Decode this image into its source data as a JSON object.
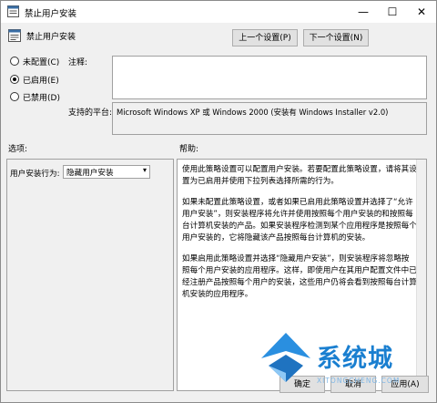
{
  "window": {
    "title": "禁止用户安装",
    "minimize_glyph": "—",
    "maximize_glyph": "☐",
    "close_glyph": "✕"
  },
  "header": {
    "policy_name": "禁止用户安装",
    "prev_button": "上一个设置(P)",
    "next_button": "下一个设置(N)"
  },
  "state": {
    "options": [
      {
        "label": "未配置(C)",
        "selected": false
      },
      {
        "label": "已启用(E)",
        "selected": true
      },
      {
        "label": "已禁用(D)",
        "selected": false
      }
    ]
  },
  "comment": {
    "label": "注释:",
    "value": ""
  },
  "platform": {
    "label": "支持的平台:",
    "value": "Microsoft Windows XP 或 Windows 2000 (安装有 Windows Installer v2.0)"
  },
  "options_panel": {
    "title": "选项:",
    "field_label": "用户安装行为:",
    "selected_value": "隐藏用户安装"
  },
  "help_panel": {
    "title": "帮助:",
    "paragraphs": [
      "使用此策略设置可以配置用户安装。若要配置此策略设置，请将其设置为已启用并使用下拉列表选择所需的行为。",
      "如果未配置此策略设置，或者如果已启用此策略设置并选择了“允许用户安装”，则安装程序将允许并使用按照每个用户安装的和按照每台计算机安装的产品。如果安装程序检测到某个应用程序是按照每个用户安装的，它将隐藏该产品按照每台计算机的安装。",
      "如果启用此策略设置并选择“隐藏用户安装”，则安装程序将忽略按照每个用户安装的应用程序。这样，即使用户在其用户配置文件中已经注册产品按照每个用户的安装，这些用户仍将会看到按照每台计算机安装的应用程序。"
    ]
  },
  "footer": {
    "ok_button": "确定",
    "cancel_button": "取消",
    "apply_button": "应用(A)"
  },
  "watermark": {
    "text": "系统城",
    "sub": "XITONGCHENG.COM"
  },
  "colors": {
    "accent": "#1a7fd0",
    "window_bg": "#f0f0f0",
    "button_bg": "#e1e1e1"
  }
}
